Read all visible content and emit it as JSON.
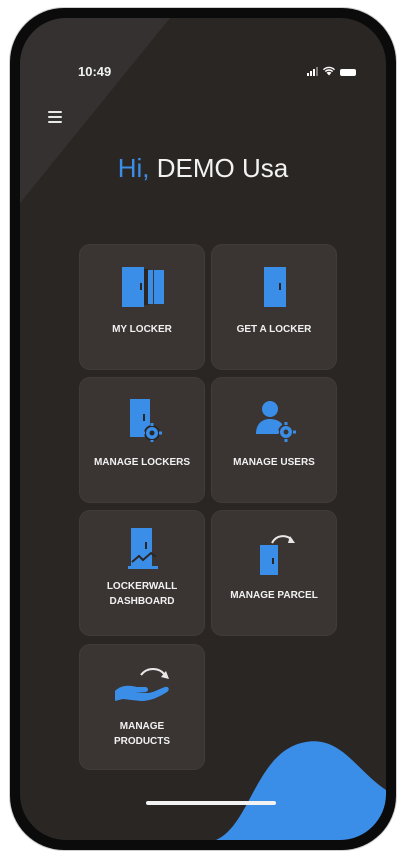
{
  "status": {
    "time": "10:49"
  },
  "greeting": {
    "prefix": "Hi,",
    "name": "DEMO Usa"
  },
  "tiles": [
    {
      "label": "MY LOCKER",
      "icon": "lockers-icon"
    },
    {
      "label": "GET A LOCKER",
      "icon": "locker-door-icon"
    },
    {
      "label": "MANAGE LOCKERS",
      "icon": "locker-gear-icon"
    },
    {
      "label": "MANAGE USERS",
      "icon": "user-gear-icon"
    },
    {
      "label": "LOCKERWALL DASHBOARD",
      "icon": "locker-dashboard-icon"
    },
    {
      "label": "MANAGE PARCEL",
      "icon": "locker-arrow-icon"
    },
    {
      "label": "MANAGE PRODUCTS",
      "icon": "hand-arrow-icon"
    }
  ],
  "colors": {
    "accent": "#3b8ee8",
    "background": "#2a2624",
    "tile": "#3a3533"
  }
}
